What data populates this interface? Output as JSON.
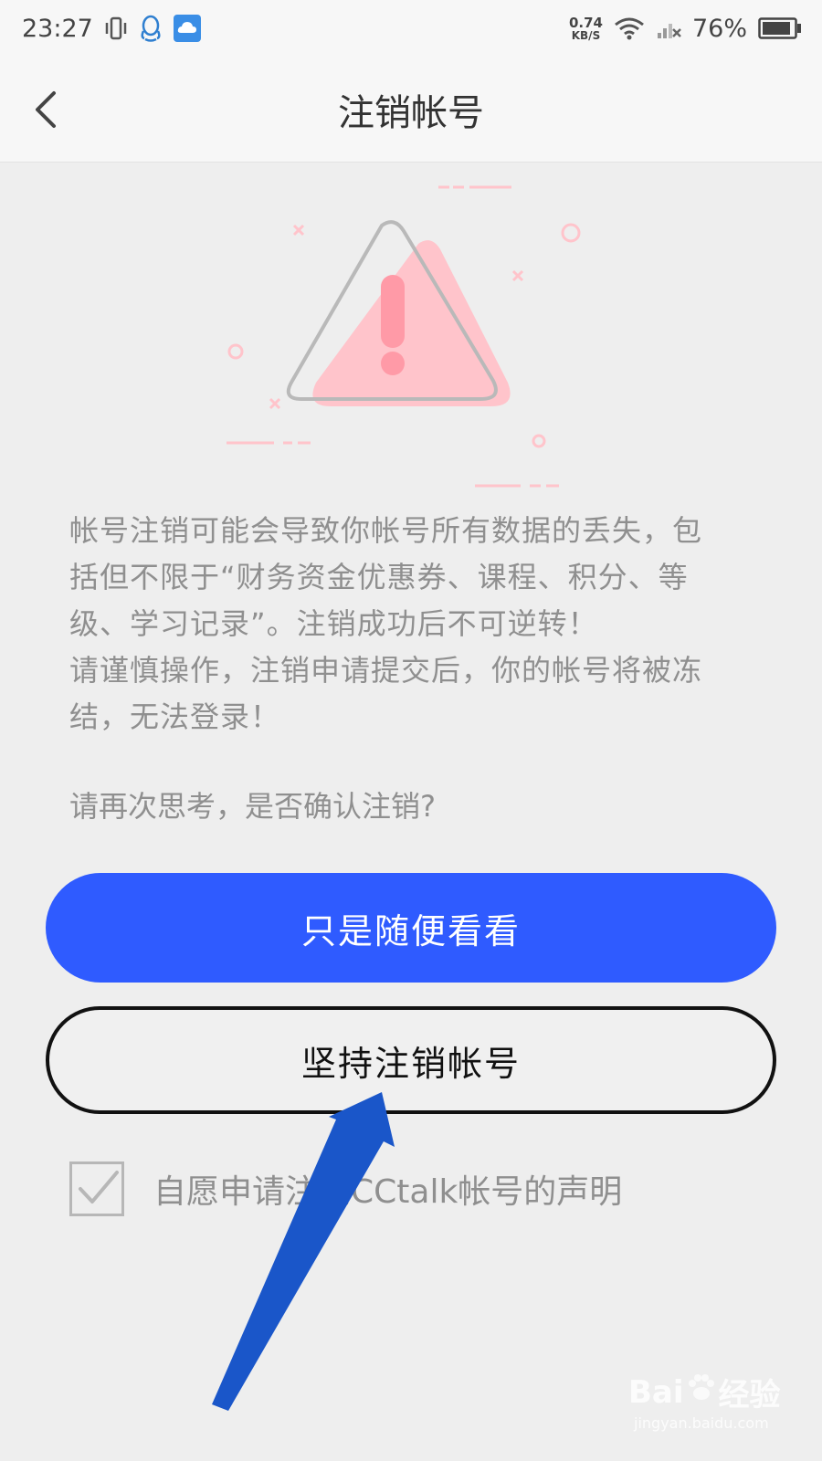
{
  "status_bar": {
    "time": "23:27",
    "net_speed_value": "0.74",
    "net_speed_unit": "KB/S",
    "battery_percent": "76%"
  },
  "nav": {
    "title": "注销帐号"
  },
  "content": {
    "warning_lines": [
      "帐号注销可能会导致你帐号所有数据的丢失，包",
      "括但不限于“财务资金优惠券、课程、积分、等",
      "级、学习记录”。注销成功后不可逆转！",
      "请谨慎操作，注销申请提交后，你的帐号将被冻",
      "结，无法登录！"
    ],
    "confirm_question": "请再次思考，是否确认注销?"
  },
  "buttons": {
    "primary_label": "只是随便看看",
    "secondary_label": "坚持注销帐号"
  },
  "agreement": {
    "checked": true,
    "label": "自愿申请注销CCtalk帐号的声明"
  },
  "watermark": {
    "logo_left": "Bai",
    "logo_right": "经验",
    "url": "jingyan.baidu.com"
  },
  "colors": {
    "primary": "#2f5bff",
    "annotation_arrow": "#1a56c9",
    "warning_pink": "#ffc4cb"
  }
}
